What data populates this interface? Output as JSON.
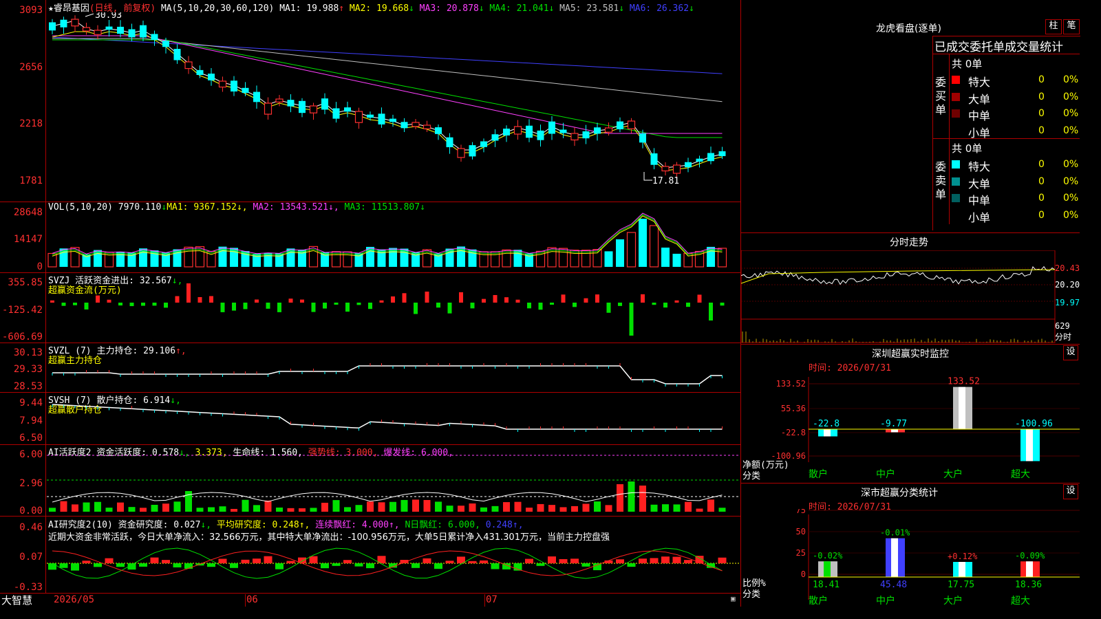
{
  "stock": {
    "star": "★",
    "name": "睿昂基因",
    "mode": "(日线, 前复权)"
  },
  "ma_header": {
    "params": "MA(5,10,20,30,60,120)",
    "items": [
      {
        "label": "MA1:",
        "value": "19.988",
        "arrow": "↑",
        "color": "#ffffff"
      },
      {
        "label": "MA2:",
        "value": "19.668",
        "arrow": "↓",
        "color": "#ffff00"
      },
      {
        "label": "MA3:",
        "value": "20.878",
        "arrow": "↓",
        "color": "#ff40ff"
      },
      {
        "label": "MA4:",
        "value": "21.041",
        "arrow": "↓",
        "color": "#00e000"
      },
      {
        "label": "MA5:",
        "value": "23.581",
        "arrow": "↓",
        "color": "#c0c0c0"
      },
      {
        "label": "MA6:",
        "value": "26.362",
        "arrow": "↓",
        "color": "#4040ff"
      }
    ]
  },
  "main_chart": {
    "y_ticks": [
      "3093",
      "2656",
      "2218",
      "1781"
    ],
    "high_label": "30.93",
    "low_label": "17.81"
  },
  "vol": {
    "title": "VOL(5,10,20)",
    "value": "7970.110",
    "arrow": "↓",
    "ma1": "MA1: 9367.152↓,",
    "ma2": "MA2: 13543.521↓,",
    "ma3": "MA3: 11513.807↓",
    "y_ticks": [
      "28648",
      "14147",
      "0"
    ]
  },
  "svzj": {
    "title": "SVZJ  活跃资金进出:",
    "value": "32.567",
    "arrow": "↓,",
    "sub": "超赢资金流(万元)",
    "y_ticks": [
      "355.85",
      "-125.42",
      "-606.69"
    ]
  },
  "svzl": {
    "title": "SVZL (7) 主力持仓:",
    "value": "29.106",
    "arrow": "↑,",
    "sub": "超赢主力持仓",
    "y_ticks": [
      "30.13",
      "29.33",
      "28.53"
    ]
  },
  "svsh": {
    "title": "SVSH (7) 散户持仓:",
    "value": "6.914",
    "arrow": "↓,",
    "sub": "超赢散户持仓",
    "y_ticks": [
      "9.44",
      "7.94",
      "6.50"
    ]
  },
  "ai1": {
    "title": "AI活跃度2 资金活跃度:",
    "v1": "0.578",
    "a1": "↓,",
    "v2": "3.373,",
    "life": "生命线: 1.560,",
    "strong": "强势线: 3.000,",
    "burst": "爆发线: 6.000,",
    "y_ticks": [
      "6.00",
      "2.96",
      "0.00"
    ]
  },
  "ai2": {
    "title": "AI研究度2(10) 资金研究度:",
    "v1": "0.027",
    "a1": "↓,",
    "avg": "平均研究度: 0.248↑,",
    "lianxu": "连续飘红: 4.000↑,",
    "nri": "N日飘红: 6.000,",
    "tail": "0.248↑,",
    "y_ticks": [
      "0.46",
      "0.07",
      "-0.33"
    ],
    "comment": "近期大资金非常活跃，今日大单净流入：32.566万元，其中特大单净流出：-100.956万元，大单5日累计净入431.301万元，当前主力控盘强"
  },
  "footer": {
    "brand": "大智慧",
    "date1": "2026/05",
    "date2": "06",
    "date3": "07"
  },
  "right": {
    "dragon_title": "龙虎看盘(逐单)",
    "btn_zhu": "柱",
    "btn_bi": "笔",
    "stats_title": "已成交委托单成交量统计",
    "buy": {
      "side": "委买单",
      "total": "共 0单",
      "rows": [
        {
          "label": "特大",
          "val": "0",
          "pct": "0%",
          "color": "#ff0000"
        },
        {
          "label": "大单",
          "val": "0",
          "pct": "0%",
          "color": "#a00000"
        },
        {
          "label": "中单",
          "val": "0",
          "pct": "0%",
          "color": "#700000"
        },
        {
          "label": "小单",
          "val": "0",
          "pct": "0%",
          "color": "#000000"
        }
      ]
    },
    "sell": {
      "side": "委卖单",
      "total": "共 0单",
      "rows": [
        {
          "label": "特大",
          "val": "0",
          "pct": "0%",
          "color": "#00ffff"
        },
        {
          "label": "大单",
          "val": "0",
          "pct": "0%",
          "color": "#009090"
        },
        {
          "label": "中单",
          "val": "0",
          "pct": "0%",
          "color": "#006060"
        },
        {
          "label": "小单",
          "val": "0",
          "pct": "0%",
          "color": "#000000"
        }
      ]
    },
    "intraday_title": "分时走势",
    "intraday_ticks": [
      "20.43",
      "20.20",
      "19.97"
    ],
    "intraday_vol": "629",
    "intraday_vol_label": "分时",
    "monitor": {
      "title": "深圳超赢实时监控",
      "btn": "设",
      "time": "时间: 2026/07/31",
      "y_ticks": [
        "133.52",
        "55.36",
        "-22.8",
        "-100.96"
      ],
      "ylab1": "净额(万元)",
      "ylab2": "分类",
      "cats": [
        "散户",
        "中户",
        "大户",
        "超大"
      ],
      "values": [
        -22.8,
        -9.77,
        133.52,
        -100.96
      ],
      "labels": [
        "-22.8",
        "-9.77",
        "133.52",
        "-100.96"
      ]
    },
    "classify": {
      "title": "深市超赢分类统计",
      "btn": "设",
      "time": "时间: 2026/07/31",
      "y_ticks": [
        "75",
        "50",
        "25",
        "0"
      ],
      "ylab1": "比例%",
      "ylab2": "分类",
      "cats": [
        "散户",
        "中户",
        "大户",
        "超大"
      ],
      "values": [
        18.41,
        45.48,
        17.75,
        18.36
      ],
      "labels": [
        "18.41",
        "45.48",
        "17.75",
        "18.36"
      ],
      "changes": [
        "-0.02%",
        "-0.01%",
        "+0.12%",
        "-0.09%"
      ]
    }
  }
}
